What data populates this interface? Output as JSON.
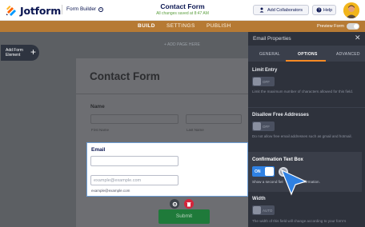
{
  "app": {
    "logo_text": "Jotform",
    "builder_label": "Form Builder",
    "form_title": "Contact Form",
    "save_status": "All changes saved at 8:47 AM",
    "add_collaborators": "Add Collaborators",
    "help": "Help"
  },
  "nav": {
    "tabs": [
      "BUILD",
      "SETTINGS",
      "PUBLISH"
    ],
    "active_tab": "BUILD",
    "preview_label": "Preview Form"
  },
  "canvas": {
    "add_element": "Add Form Element",
    "add_page": "+ ADD PAGE HERE",
    "form_header": "Contact Form",
    "name_field": {
      "label": "Name",
      "first_sub": "First Name",
      "last_sub": "Last Name"
    },
    "email_field": {
      "label": "Email",
      "placeholder": "example@example.com",
      "hint": "example@example.com"
    },
    "submit_label": "Submit"
  },
  "panel": {
    "title": "Email Properties",
    "tabs": [
      "GENERAL",
      "OPTIONS",
      "ADVANCED"
    ],
    "active_tab": "OPTIONS",
    "limit_entry": {
      "title": "Limit Entry",
      "toggle": "OFF",
      "desc": "Limit the maximum number of characters allowed for this field."
    },
    "disallow_free": {
      "title": "Disallow Free Addresses",
      "toggle": "OFF",
      "desc": "Do not allow free email addresses such as gmail and hotmail."
    },
    "confirmation": {
      "title": "Confirmation Text Box",
      "toggle": "ON",
      "desc": "Show a second fiel",
      "desc_end": "confirmation."
    },
    "width": {
      "title": "Width",
      "toggle": "AUTO",
      "desc": "The width of this field will change according to your form's"
    }
  },
  "colors": {
    "brand_orange": "#f7a13b",
    "panel_bg": "#2e323c",
    "toggle_on": "#2f81e3",
    "submit_green": "#1f7a3a",
    "delete_red": "#d3253b"
  }
}
